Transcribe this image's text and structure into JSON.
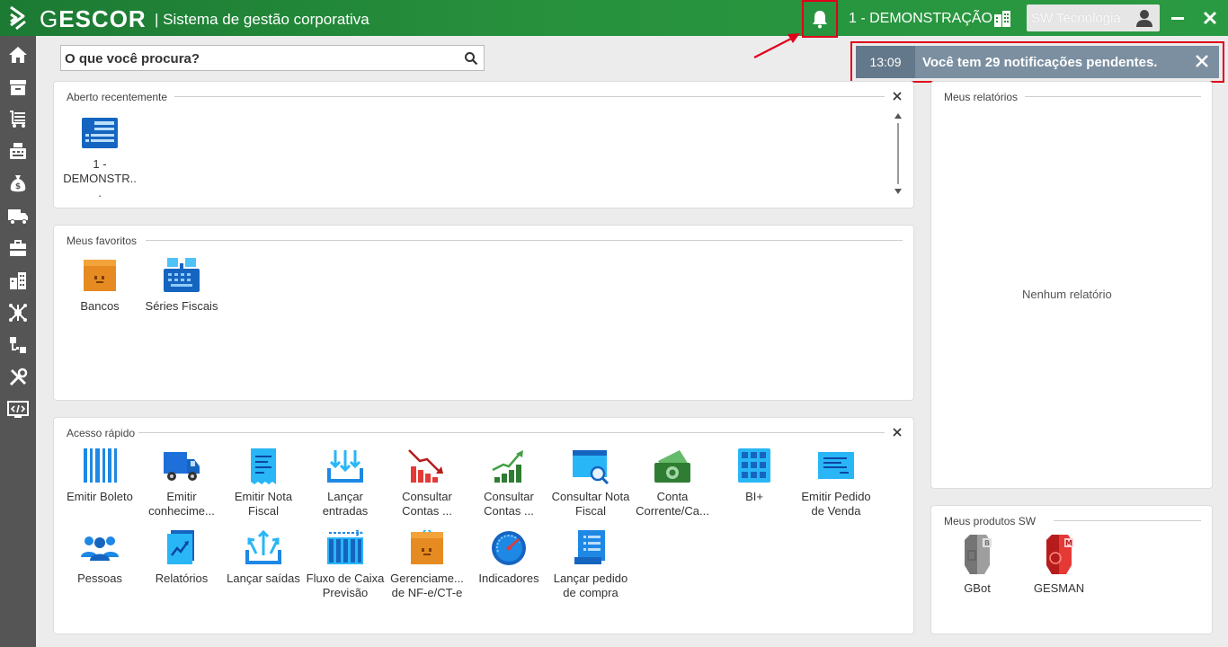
{
  "header": {
    "brand_g": "G",
    "brand_rest": "ESCOR",
    "subtitle": "| Sistema de gestão corporativa",
    "company": "1 - DEMONSTRAÇÃO",
    "user": "SW Tecnologia",
    "accent_color": "#27913d"
  },
  "search": {
    "placeholder": "O que você procura?"
  },
  "notification": {
    "time": "13:09",
    "text": "Você tem 29 notificações pendentes."
  },
  "sidebar": {
    "items": [
      "home-icon",
      "archive-icon",
      "cart-list-icon",
      "register-icon",
      "money-bag-icon",
      "truck-icon",
      "briefcase-icon",
      "buildings-icon",
      "network-icon",
      "flow-icon",
      "tools-icon",
      "code-monitor-icon"
    ]
  },
  "recent": {
    "title": "Aberto recentemente",
    "items": [
      {
        "label": "1 - DEMONSTR...",
        "icon": "company-card-icon"
      }
    ]
  },
  "favorites": {
    "title": "Meus favoritos",
    "items": [
      {
        "label": "Bancos",
        "icon": "safe-icon"
      },
      {
        "label": "Séries Fiscais",
        "icon": "register-machine-icon"
      }
    ]
  },
  "quick": {
    "title": "Acesso rápido",
    "items": [
      {
        "label": "Emitir Boleto",
        "icon": "barcode-icon"
      },
      {
        "label": "Emitir conhecime...",
        "icon": "truck-icon"
      },
      {
        "label": "Emitir Nota Fiscal",
        "icon": "receipt-icon"
      },
      {
        "label": "Lançar entradas",
        "icon": "inbox-in-icon"
      },
      {
        "label": "Consultar Contas ...",
        "icon": "chart-down-icon"
      },
      {
        "label": "Consultar Contas ...",
        "icon": "chart-up-icon"
      },
      {
        "label": "Consultar Nota Fiscal",
        "icon": "search-doc-icon"
      },
      {
        "label": "Conta Corrente/Ca...",
        "icon": "cash-icon"
      },
      {
        "label": "BI+",
        "icon": "grid-icon"
      },
      {
        "label": "Emitir Pedido de Venda",
        "icon": "order-icon"
      },
      {
        "label": "Pessoas",
        "icon": "people-icon"
      },
      {
        "label": "Relatórios",
        "icon": "report-icon"
      },
      {
        "label": "Lançar saídas",
        "icon": "inbox-out-icon"
      },
      {
        "label": "Fluxo de Caixa Previsão",
        "icon": "cashflow-icon"
      },
      {
        "label": "Gerenciame... de NF-e/CT-e",
        "icon": "box-icon"
      },
      {
        "label": "Indicadores",
        "icon": "gauge-icon"
      },
      {
        "label": "Lançar pedido de compra",
        "icon": "purchase-icon"
      }
    ]
  },
  "reports": {
    "title": "Meus relatórios",
    "empty": "Nenhum relatório"
  },
  "products": {
    "title": "Meus produtos SW",
    "items": [
      {
        "label": "GBot",
        "icon": "gbot-icon"
      },
      {
        "label": "GESMAN",
        "icon": "gesman-icon"
      }
    ]
  }
}
